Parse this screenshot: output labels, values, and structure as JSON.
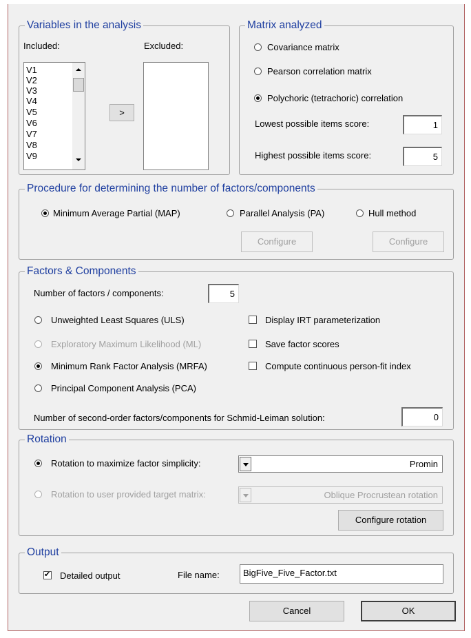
{
  "variables": {
    "title": "Variables in the analysis",
    "included_label": "Included:",
    "excluded_label": "Excluded:",
    "included_items": [
      "V1",
      "V2",
      "V3",
      "V4",
      "V5",
      "V6",
      "V7",
      "V8",
      "V9"
    ],
    "move_button": ">"
  },
  "matrix": {
    "title": "Matrix analyzed",
    "options": [
      "Covariance matrix",
      "Pearson correlation matrix",
      "Polychoric (tetrachoric) correlation"
    ],
    "selected": "Polychoric (tetrachoric) correlation",
    "lowest_label": "Lowest possible items score:",
    "lowest_value": "1",
    "highest_label": "Highest possible items score:",
    "highest_value": "5"
  },
  "procedure": {
    "title": "Procedure for determining the number of factors/components",
    "options": [
      "Minimum Average Partial (MAP)",
      "Parallel Analysis (PA)",
      "Hull method"
    ],
    "selected": "Minimum Average Partial (MAP)",
    "configure_pa": "Configure",
    "configure_hull": "Configure"
  },
  "factors": {
    "title": "Factors & Components",
    "num_label": "Number of factors / components:",
    "num_value": "5",
    "methods": [
      "Unweighted Least Squares (ULS)",
      "Exploratory Maximum Likelihood (ML)",
      "Minimum Rank Factor Analysis (MRFA)",
      "Principal Component Analysis (PCA)"
    ],
    "selected_method": "Minimum Rank Factor Analysis (MRFA)",
    "checks": [
      "Display IRT parameterization",
      "Save factor scores",
      "Compute continuous person-fit index"
    ],
    "second_order_label": "Number of second-order factors/components for Schmid-Leiman solution:",
    "second_order_value": "0"
  },
  "rotation": {
    "title": "Rotation",
    "opt1": "Rotation to maximize factor simplicity:",
    "opt1_value": "Promin",
    "opt2": "Rotation to user provided target matrix:",
    "opt2_value": "Oblique Procrustean rotation",
    "configure": "Configure rotation"
  },
  "output": {
    "title": "Output",
    "detailed": "Detailed output",
    "detailed_checked": true,
    "file_label": "File name:",
    "file_value": "BigFive_Five_Factor.txt"
  },
  "buttons": {
    "cancel": "Cancel",
    "ok": "OK"
  }
}
